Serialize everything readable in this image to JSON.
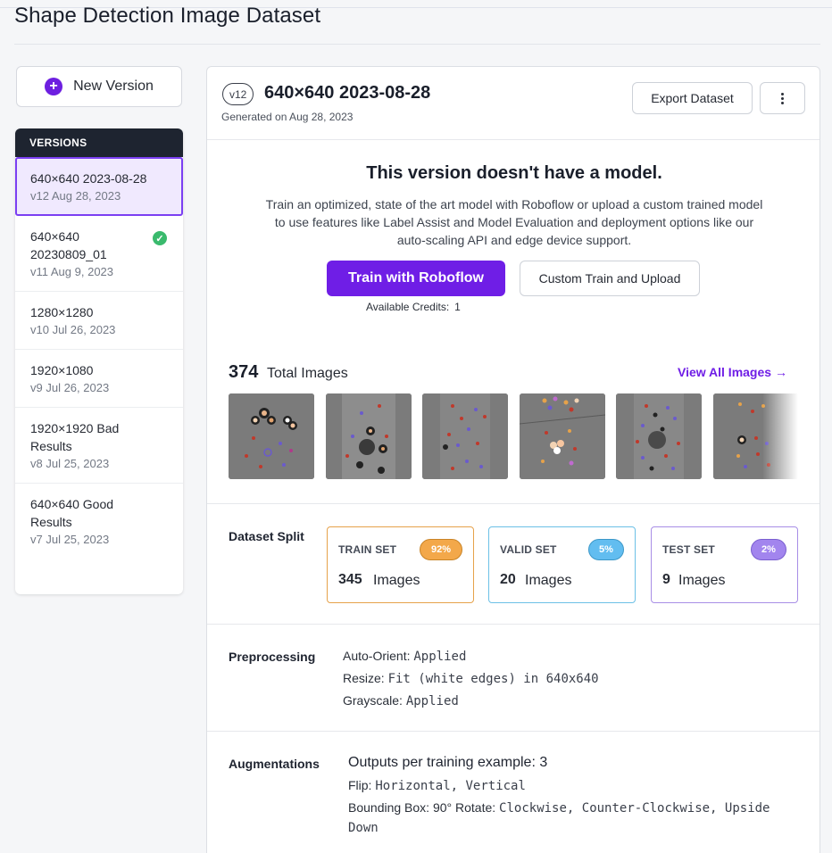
{
  "page": {
    "title": "Shape Detection Image Dataset"
  },
  "sidebar": {
    "new_version_label": "New Version",
    "versions_header": "VERSIONS",
    "versions": [
      {
        "name": "640×640 2023-08-28",
        "meta": "v12 Aug 28, 2023",
        "active": true,
        "trained": false
      },
      {
        "name": "640×640 20230809_01",
        "meta": "v11 Aug 9, 2023",
        "active": false,
        "trained": true
      },
      {
        "name": "1280×1280",
        "meta": "v10 Jul 26, 2023",
        "active": false,
        "trained": false
      },
      {
        "name": "1920×1080",
        "meta": "v9 Jul 26, 2023",
        "active": false,
        "trained": false
      },
      {
        "name": "1920×1920 Bad Results",
        "meta": "v8 Jul 25, 2023",
        "active": false,
        "trained": false
      },
      {
        "name": "640×640 Good Results",
        "meta": "v7 Jul 25, 2023",
        "active": false,
        "trained": false
      }
    ]
  },
  "version": {
    "pill": "v12",
    "title": "640×640 2023-08-28",
    "generated": "Generated on Aug 28, 2023",
    "export_label": "Export Dataset",
    "more_icon": "more-vertical-icon"
  },
  "no_model": {
    "title": "This version doesn't have a model.",
    "description": "Train an optimized, state of the art model with Roboflow or upload a custom trained model to use features like Label Assist and Model Evaluation and deployment options like our auto-scaling API and edge device support.",
    "train_label": "Train with Roboflow",
    "custom_label": "Custom Train and Upload",
    "credits_label": "Available Credits:",
    "credits_value": "1"
  },
  "images": {
    "total": "374",
    "total_label": "Total Images",
    "view_all_label": "View All Images →",
    "thumbnail_count": 6
  },
  "split": {
    "label": "Dataset Split",
    "cards": [
      {
        "name": "TRAIN SET",
        "badge": "92%",
        "count": "345",
        "unit": "Images",
        "border": "#e6a24a",
        "badge_bg": "#f3a84a",
        "badge_fg": "#ffffff"
      },
      {
        "name": "VALID SET",
        "badge": "5%",
        "count": "20",
        "unit": "Images",
        "border": "#6cc0e6",
        "badge_bg": "#62bdf0",
        "badge_fg": "#ffffff"
      },
      {
        "name": "TEST SET",
        "badge": "2%",
        "count": "9",
        "unit": "Images",
        "border": "#a88ee6",
        "badge_bg": "#a285ee",
        "badge_fg": "#ffffff"
      }
    ]
  },
  "preprocessing": {
    "label": "Preprocessing",
    "items": [
      {
        "key": "Auto-Orient:",
        "value": "Applied"
      },
      {
        "key": "Resize:",
        "value": "Fit (white edges) in 640x640"
      },
      {
        "key": "Grayscale:",
        "value": "Applied"
      }
    ]
  },
  "augmentations": {
    "label": "Augmentations",
    "outputs": "Outputs per training example: 3",
    "flip_key": "Flip:",
    "flip_value": "Horizontal, Vertical",
    "bbox_key": "Bounding Box: 90° Rotate:",
    "bbox_value_1": "Clockwise, Counter-Clockwise, Upside",
    "bbox_value_2": "Down"
  },
  "colors": {
    "accent": "#6f1ee6",
    "active_border": "#7b3ff2",
    "success": "#3aba6d"
  }
}
